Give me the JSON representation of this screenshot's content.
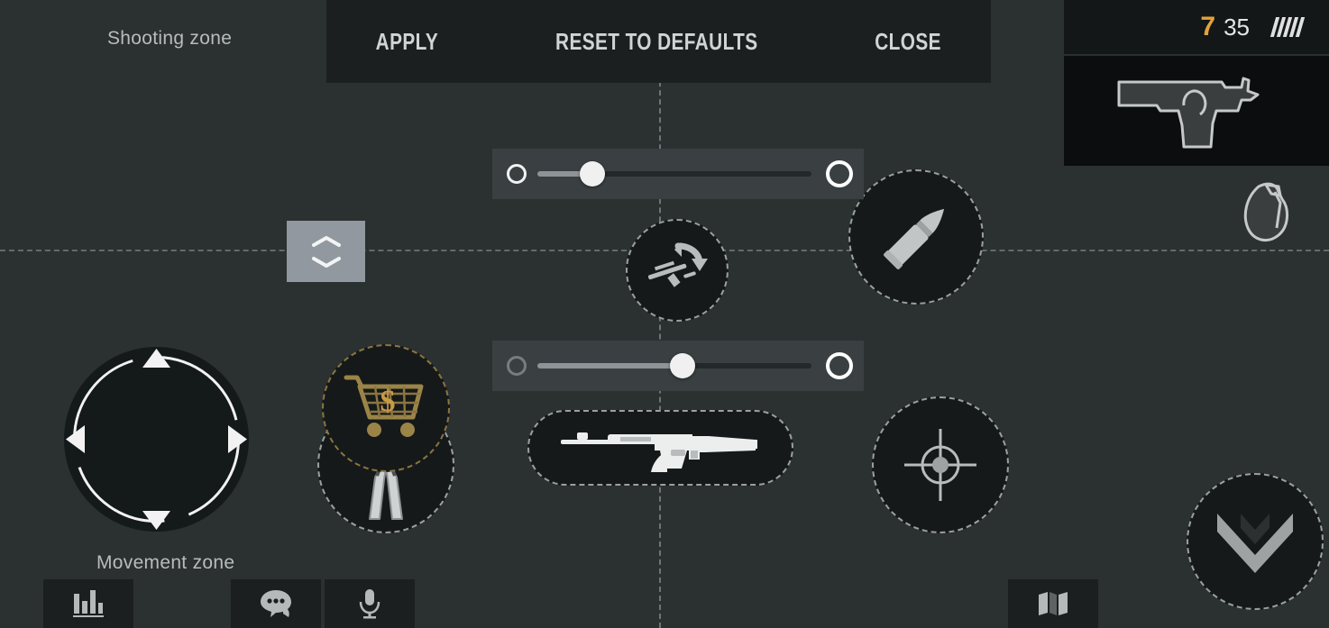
{
  "topbar": {
    "apply_label": "APPLY",
    "reset_label": "RESET TO DEFAULTS",
    "close_label": "CLOSE"
  },
  "zones": {
    "shooting_label": "Shooting zone",
    "movement_label": "Movement zone"
  },
  "sliders": [
    {
      "name": "shooting-zone-size",
      "value": 20,
      "min_icon": "minus-circle-icon",
      "max_icon": "plus-circle-icon"
    },
    {
      "name": "movement-zone-size",
      "value": 53,
      "min_icon": "minus-circle-icon",
      "max_icon": "plus-circle-icon"
    }
  ],
  "hud": {
    "joystick": "movement-joystick",
    "swap_weapon": "weapon-swap-icon",
    "reload": "bullet-icon",
    "buy_menu": "shopping-cart-dollar-icon",
    "defuse": "pliers-icon",
    "primary_weapon": "assault-rifle-icon",
    "aim": "crosshair-icon",
    "crouch": "double-chevron-down-icon",
    "resize_handle": "vertical-resize-handle"
  },
  "weapon_panel": {
    "ammo_current": "7",
    "ammo_reserve": "35",
    "magazine_ticks": 5,
    "weapon_icon": "pistol-icon",
    "grenade_icon": "grenade-icon"
  },
  "bottom_bar": {
    "scoreboard": "scoreboard-icon",
    "chat": "chat-icon",
    "microphone": "microphone-icon",
    "map": "map-icon"
  },
  "colors": {
    "background": "#2b3031",
    "panel": "#1b1f20",
    "accent_gold": "#e3a23c",
    "guide": "#9aa0a2"
  }
}
